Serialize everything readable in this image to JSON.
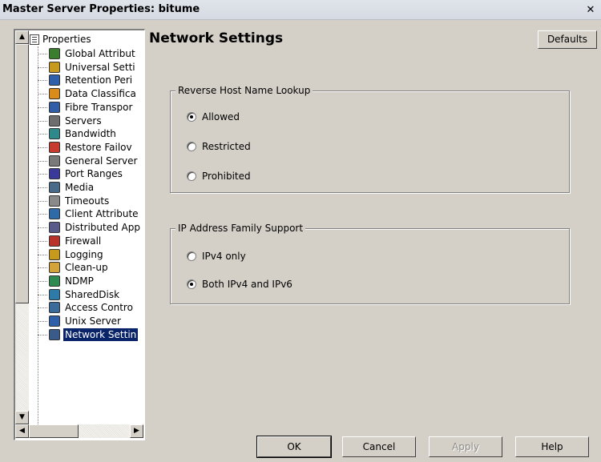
{
  "window": {
    "title": "Master Server Properties: bitume",
    "close_label": "✕"
  },
  "tree": {
    "root_label": "Properties",
    "items": [
      {
        "label": "Global Attribut",
        "icon": "globe-icon",
        "color": "#3b7d2e"
      },
      {
        "label": "Universal Setti",
        "icon": "gear-icon",
        "color": "#c79a1e"
      },
      {
        "label": "Retention Peri",
        "icon": "calendar-icon",
        "color": "#2e5fa8"
      },
      {
        "label": "Data Classifica",
        "icon": "classification-icon",
        "color": "#d98c1a"
      },
      {
        "label": "Fibre Transpor",
        "icon": "monitor-icon",
        "color": "#2f5ea6"
      },
      {
        "label": "Servers",
        "icon": "server-icon",
        "color": "#6e6e6e"
      },
      {
        "label": "Bandwidth",
        "icon": "bandwidth-icon",
        "color": "#2e8a8a"
      },
      {
        "label": "Restore Failov",
        "icon": "restore-icon",
        "color": "#c63b2e"
      },
      {
        "label": "General Server",
        "icon": "server-icon",
        "color": "#7a7a7a"
      },
      {
        "label": "Port Ranges",
        "icon": "port-icon",
        "color": "#3a3a9a"
      },
      {
        "label": "Media",
        "icon": "media-icon",
        "color": "#4a6a8a"
      },
      {
        "label": "Timeouts",
        "icon": "clock-icon",
        "color": "#8a8a8a"
      },
      {
        "label": "Client Attribute",
        "icon": "client-icon",
        "color": "#2e6aa8"
      },
      {
        "label": "Distributed App",
        "icon": "distributed-icon",
        "color": "#5a5a8a"
      },
      {
        "label": "Firewall",
        "icon": "firewall-icon",
        "color": "#b8322a"
      },
      {
        "label": "Logging",
        "icon": "log-icon",
        "color": "#c79a1e"
      },
      {
        "label": "Clean-up",
        "icon": "cleanup-icon",
        "color": "#d4a43a"
      },
      {
        "label": "NDMP",
        "icon": "ndmp-icon",
        "color": "#2e8a4e"
      },
      {
        "label": "SharedDisk",
        "icon": "shared-disk-icon",
        "color": "#2e7aa8"
      },
      {
        "label": "Access Contro",
        "icon": "access-control-icon",
        "color": "#3a6a9a"
      },
      {
        "label": "Unix Server",
        "icon": "unix-server-icon",
        "color": "#2e5fa8"
      },
      {
        "label": "Network Settin",
        "icon": "network-icon",
        "color": "#3a5a8a",
        "selected": true
      }
    ]
  },
  "main": {
    "title": "Network Settings",
    "defaults_label": "Defaults",
    "reverse_lookup": {
      "title": "Reverse Host Name Lookup",
      "options": [
        {
          "label": "Allowed",
          "checked": true
        },
        {
          "label": "Restricted",
          "checked": false
        },
        {
          "label": "Prohibited",
          "checked": false
        }
      ]
    },
    "ip_family": {
      "title": "IP Address Family Support",
      "options": [
        {
          "label": "IPv4 only",
          "checked": false
        },
        {
          "label": "Both IPv4 and IPv6",
          "checked": true
        }
      ]
    }
  },
  "buttons": {
    "ok": "OK",
    "cancel": "Cancel",
    "apply": "Apply",
    "help": "Help"
  }
}
